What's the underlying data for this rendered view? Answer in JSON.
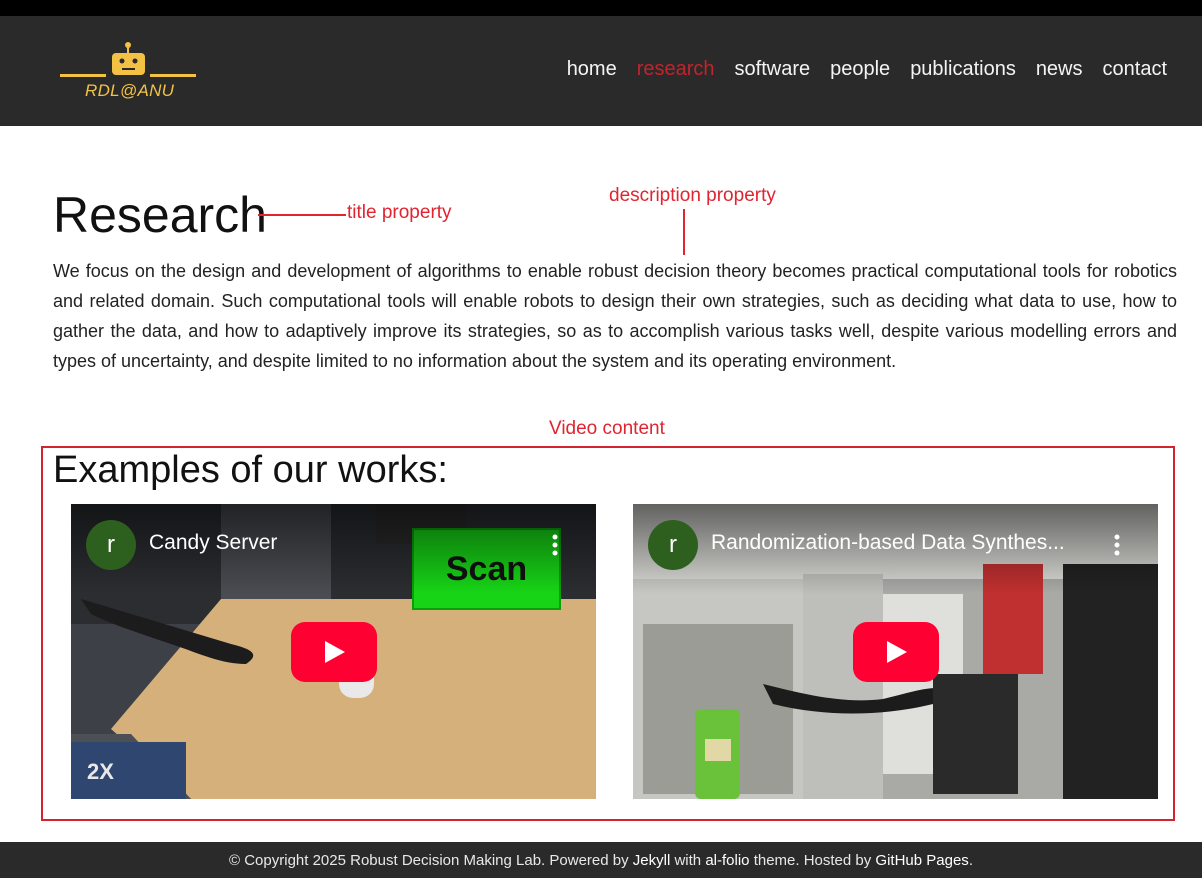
{
  "brand": {
    "logo_text": "RDL@ANU"
  },
  "nav": [
    {
      "label": "home",
      "active": false
    },
    {
      "label": "research",
      "active": true
    },
    {
      "label": "software",
      "active": false
    },
    {
      "label": "people",
      "active": false
    },
    {
      "label": "publications",
      "active": false
    },
    {
      "label": "news",
      "active": false
    },
    {
      "label": "contact",
      "active": false
    }
  ],
  "page": {
    "title": "Research",
    "description": "We focus on the design and development of algorithms to enable robust decision theory becomes practical computational tools for robotics and related domain. Such computational tools will enable robots to design their own strategies, such as deciding what data to use, how to gather the data, and how to adaptively improve its strategies, so as to accomplish various tasks well, despite various modelling errors and types of uncertainty, and despite limited to no information about the system and its operating environment."
  },
  "annotations": {
    "title": "title property",
    "description": "description property",
    "video": "Video content"
  },
  "examples": {
    "heading": "Examples of our works:",
    "videos": [
      {
        "channel_initial": "r",
        "title": "Candy Server",
        "overlay_text": "Scan",
        "speed_text": "2X"
      },
      {
        "channel_initial": "r",
        "title": "Randomization-based Data Synthes..."
      }
    ]
  },
  "footer": {
    "prefix": "© Copyright 2025 Robust Decision Making Lab. Powered by ",
    "jekyll": "Jekyll",
    "with": " with ",
    "alfolio": "al-folio",
    "hosted": " theme. Hosted by ",
    "github": "GitHub Pages",
    "suffix": "."
  },
  "colors": {
    "accent": "#c0242c",
    "annotation": "#e02430",
    "logo": "#f3c244",
    "nav_bg": "#2a2a2a",
    "play": "#ff0033"
  }
}
